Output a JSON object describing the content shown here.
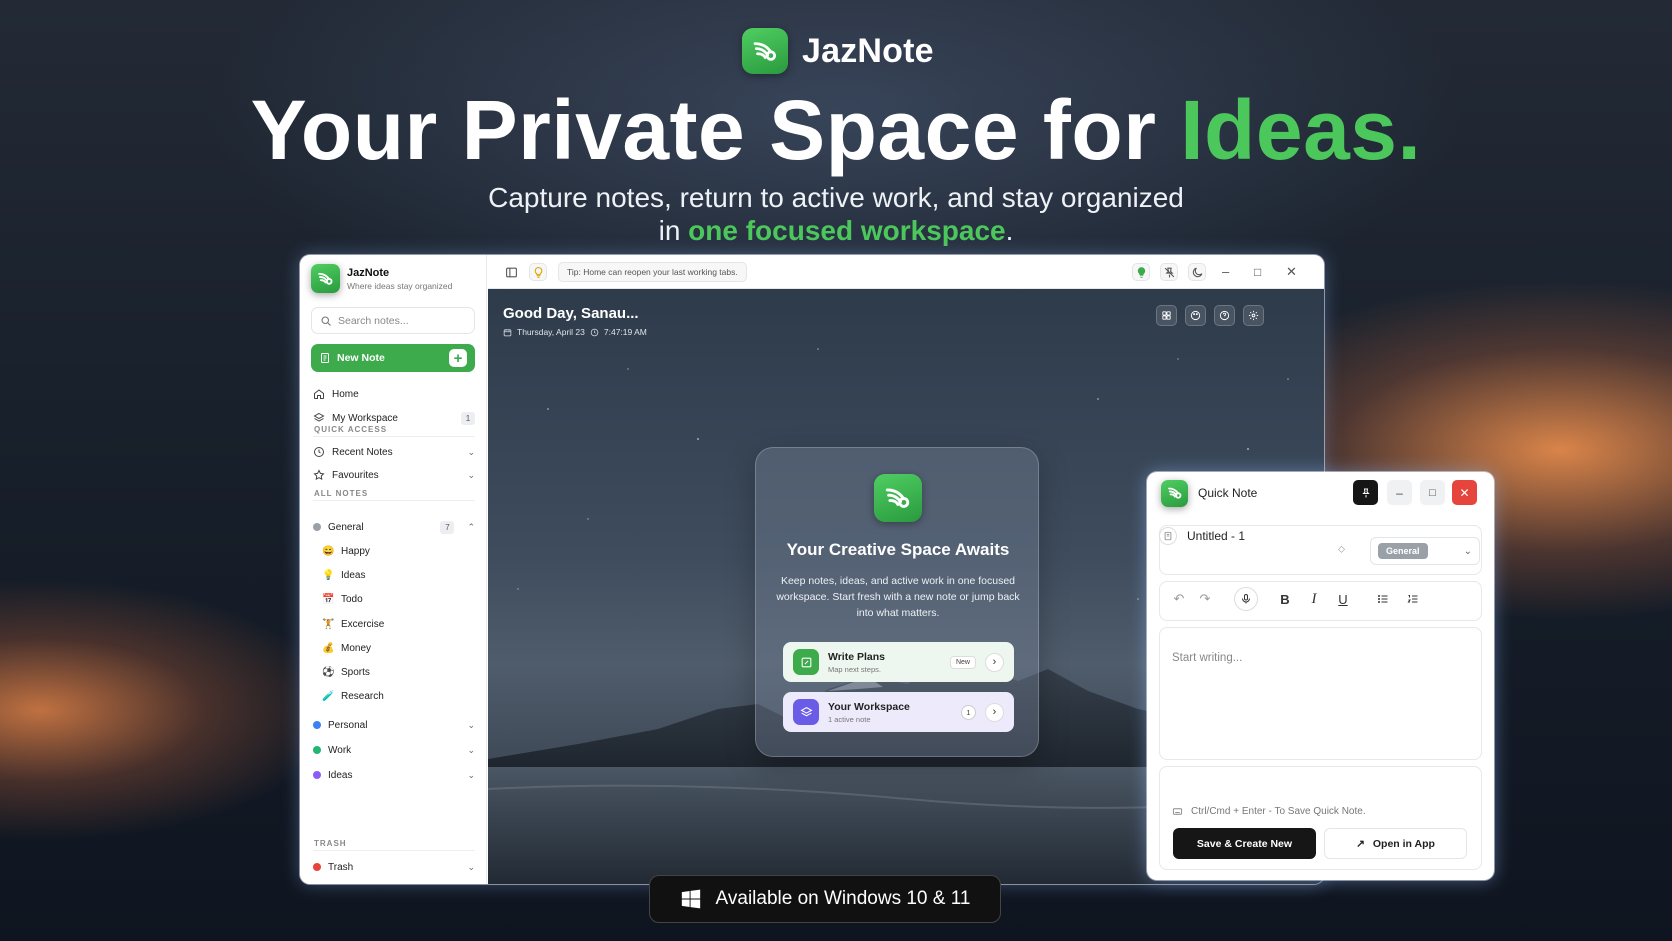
{
  "hero": {
    "brand": "JazNote",
    "title_main": "Your Private Space for ",
    "title_accent": "Ideas.",
    "subtitle_line1": "Capture notes, return to active work, and stay organized",
    "subtitle_prefix": "in ",
    "subtitle_accent": "one focused workspace",
    "subtitle_suffix": "."
  },
  "colors": {
    "accent_green": "#4cc75b",
    "brand_green": "#3daa4c",
    "close_red": "#e5453d",
    "workspace_purple": "#6b5ce7"
  },
  "sidebar": {
    "app_name": "JazNote",
    "tagline": "Where ideas stay organized",
    "search_placeholder": "Search notes...",
    "new_note_label": "New Note",
    "new_note_icon": "+",
    "home_label": "Home",
    "workspace_label": "My Workspace",
    "workspace_count": "1",
    "quick_access_title": "QUICK ACCESS",
    "recent_notes_label": "Recent Notes",
    "favourites_label": "Favourites",
    "all_notes_title": "ALL NOTES",
    "general_label": "General",
    "general_count": "7",
    "general_items": [
      {
        "label": "Happy",
        "emoji": "😄"
      },
      {
        "label": "Ideas",
        "emoji": "💡"
      },
      {
        "label": "Todo",
        "emoji": "📅"
      },
      {
        "label": "Excercise",
        "emoji": "🏋"
      },
      {
        "label": "Money",
        "emoji": "💰"
      },
      {
        "label": "Sports",
        "emoji": "⚽"
      },
      {
        "label": "Research",
        "emoji": "🧪"
      }
    ],
    "personal_label": "Personal",
    "work_label": "Work",
    "ideas_label": "Ideas",
    "trash_title": "TRASH",
    "trash_label": "Trash"
  },
  "topbar": {
    "tip": "Tip: Home can reopen your last working tabs."
  },
  "home": {
    "greeting": "Good Day, Sanau...",
    "date": "Thursday, April 23",
    "time": "7:47:19 AM",
    "card_title": "Your Creative Space Awaits",
    "card_body": "Keep notes, ideas, and active work in one focused workspace. Start fresh with a new note or jump back into what matters.",
    "write_plans_title": "Write Plans",
    "write_plans_sub": "Map next steps.",
    "write_plans_badge": "New",
    "workspace_title": "Your Workspace",
    "workspace_sub": "1 active note",
    "workspace_count": "1"
  },
  "quick_note": {
    "title": "Quick Note",
    "note_name": "Untitled - 1",
    "category": "General",
    "placeholder": "Start writing...",
    "hint": "Ctrl/Cmd + Enter - To Save Quick Note.",
    "save_label": "Save & Create New",
    "open_label": "Open in App"
  },
  "footer": {
    "available": "Available on Windows 10 & 11"
  }
}
